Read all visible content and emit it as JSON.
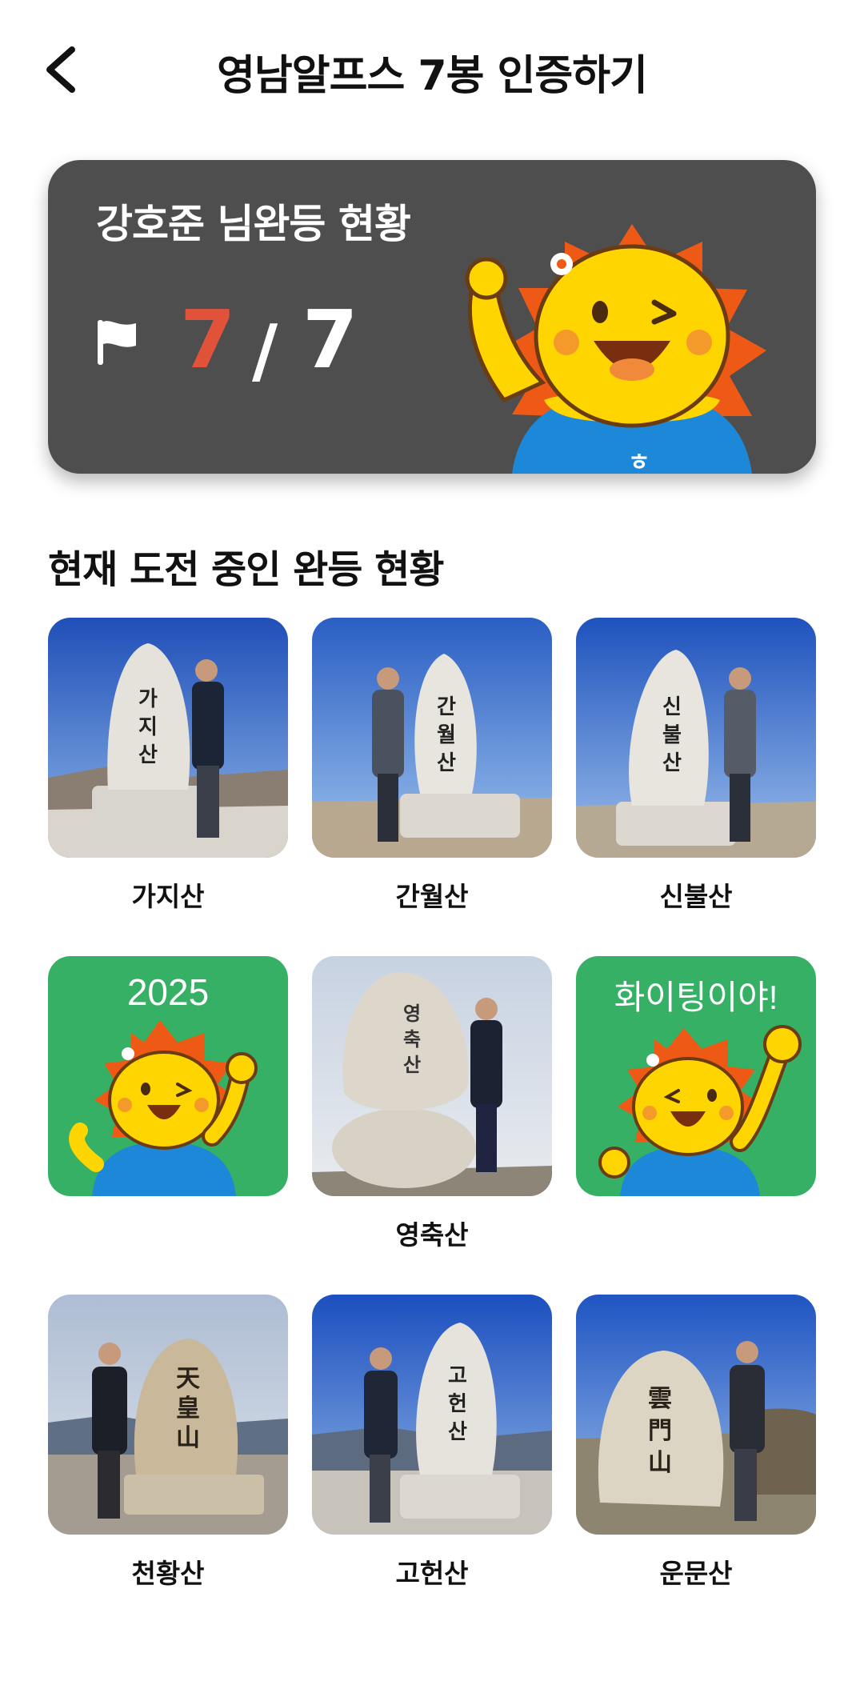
{
  "header": {
    "title": "영남알프스 7봉 인증하기"
  },
  "status_card": {
    "title": "강호준 님완등 현황",
    "completed": "7",
    "separator": "/",
    "total": "7"
  },
  "section": {
    "title": "현재 도전 중인 완등 현황"
  },
  "mountains": [
    {
      "label": "가지산",
      "stone_text": "가지산"
    },
    {
      "label": "간월산",
      "stone_text": "간월산"
    },
    {
      "label": "신불산",
      "stone_text": "신불산"
    },
    {
      "label": "",
      "banner_text": "2025"
    },
    {
      "label": "영축산",
      "stone_text": "영축산"
    },
    {
      "label": "",
      "banner_text": "화이팅이야!"
    },
    {
      "label": "천황산",
      "stone_text": "天皇山"
    },
    {
      "label": "고헌산",
      "stone_text": "고헌산"
    },
    {
      "label": "운문산",
      "stone_text": "雲門山"
    }
  ],
  "colors": {
    "card_bg": "#4e4e4e",
    "accent_red": "#e0533a",
    "tile_green": "#35b064",
    "mascot_yellow": "#ffd500",
    "mascot_orange": "#ee5a16",
    "mascot_blue": "#1e88d8"
  },
  "icons": [
    "chevron-left-icon",
    "flag-icon"
  ]
}
